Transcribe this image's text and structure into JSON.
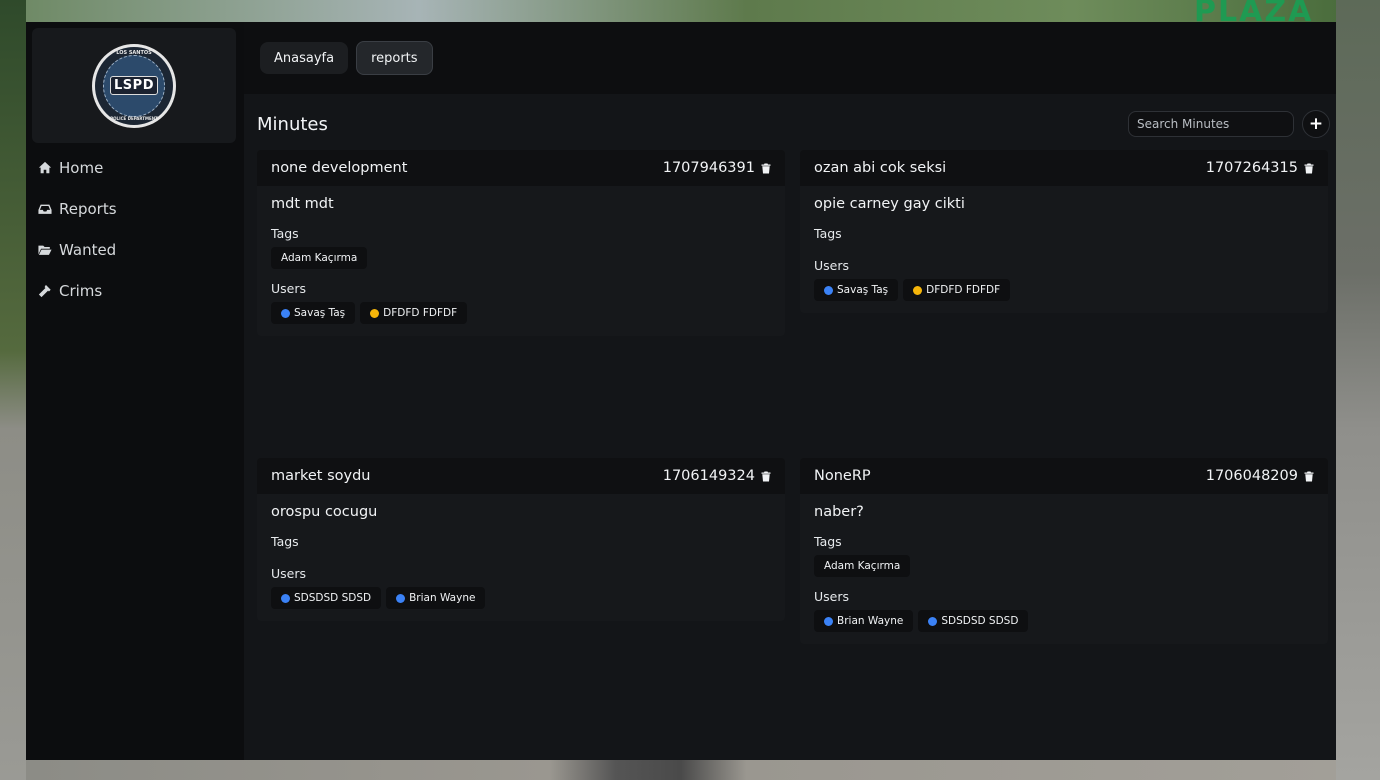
{
  "background": {
    "sign_text": "PLAZA"
  },
  "logo": {
    "top_text": "LOS SANTOS",
    "main_text": "LSPD",
    "bottom_text": "POLICE DEPARTMENT"
  },
  "sidebar": {
    "items": [
      {
        "label": "Home",
        "icon": "home-icon"
      },
      {
        "label": "Reports",
        "icon": "inbox-icon"
      },
      {
        "label": "Wanted",
        "icon": "folder-open-icon"
      },
      {
        "label": "Crims",
        "icon": "gavel-icon"
      }
    ]
  },
  "tabs": [
    {
      "label": "Anasayfa",
      "active": false
    },
    {
      "label": "reports",
      "active": true
    }
  ],
  "page": {
    "title": "Minutes",
    "search_placeholder": "Search Minutes",
    "add_label": "+"
  },
  "labels": {
    "tags": "Tags",
    "users": "Users"
  },
  "colors": {
    "blue_dot": "#3b82f6",
    "yellow_dot": "#f5b50a"
  },
  "cards": [
    {
      "title": "none development",
      "id": "1707946391",
      "description": "mdt mdt",
      "tags": [
        "Adam Kaçırma"
      ],
      "users": [
        {
          "name": "Savaş Taş",
          "dot": "blue"
        },
        {
          "name": "DFDFD FDFDF",
          "dot": "yellow"
        }
      ]
    },
    {
      "title": "ozan abi cok seksi",
      "id": "1707264315",
      "description": "opie carney gay cikti",
      "tags": [],
      "users": [
        {
          "name": "Savaş Taş",
          "dot": "blue"
        },
        {
          "name": "DFDFD FDFDF",
          "dot": "yellow"
        }
      ]
    },
    {
      "title": "market soydu",
      "id": "1706149324",
      "description": "orospu cocugu",
      "tags": [],
      "users": [
        {
          "name": "SDSDSD SDSD",
          "dot": "blue"
        },
        {
          "name": "Brian Wayne",
          "dot": "blue"
        }
      ]
    },
    {
      "title": "NoneRP",
      "id": "1706048209",
      "description": "naber?",
      "tags": [
        "Adam Kaçırma"
      ],
      "users": [
        {
          "name": "Brian Wayne",
          "dot": "blue"
        },
        {
          "name": "SDSDSD SDSD",
          "dot": "blue"
        }
      ]
    }
  ]
}
